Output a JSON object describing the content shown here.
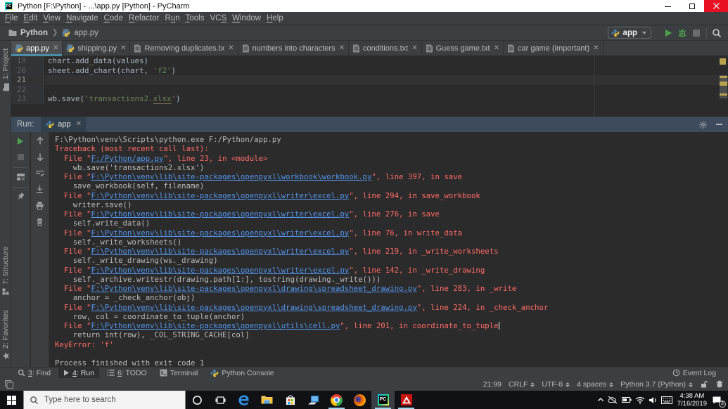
{
  "window": {
    "title": "Python [F:\\Python] - ...\\app.py [Python] - PyCharm",
    "controls": [
      "minimize",
      "maximize",
      "close"
    ]
  },
  "menu": {
    "items": [
      {
        "label": "File",
        "mnemonic": 0
      },
      {
        "label": "Edit",
        "mnemonic": 0
      },
      {
        "label": "View",
        "mnemonic": 0
      },
      {
        "label": "Navigate",
        "mnemonic": 0
      },
      {
        "label": "Code",
        "mnemonic": 0
      },
      {
        "label": "Refactor",
        "mnemonic": 0
      },
      {
        "label": "Run",
        "mnemonic": 1
      },
      {
        "label": "Tools",
        "mnemonic": 0
      },
      {
        "label": "VCS",
        "mnemonic": 2
      },
      {
        "label": "Window",
        "mnemonic": 0
      },
      {
        "label": "Help",
        "mnemonic": 0
      }
    ]
  },
  "toolbar": {
    "breadcrumb": [
      {
        "label": "Python",
        "icon": "folder-icon"
      },
      {
        "label": "app.py",
        "icon": "python-file-icon"
      }
    ],
    "run_config": {
      "label": "app",
      "icon": "python-icon"
    },
    "buttons": [
      "run-button",
      "debug-button",
      "stop-button",
      "search-everywhere-button"
    ]
  },
  "editor_tabs": [
    {
      "label": "app.py",
      "icon": "python-file-icon",
      "active": true
    },
    {
      "label": "shipping.py",
      "icon": "python-file-icon",
      "active": false
    },
    {
      "label": "Removing duplicates.tx",
      "icon": "text-file-icon",
      "active": false
    },
    {
      "label": "numbers into characters",
      "icon": "text-file-icon",
      "active": false
    },
    {
      "label": "conditions.txt",
      "icon": "text-file-icon",
      "active": false
    },
    {
      "label": "Guess game.txt",
      "icon": "text-file-icon",
      "active": false
    },
    {
      "label": "car game (important)",
      "icon": "text-file-icon",
      "active": false
    }
  ],
  "editor": {
    "lines": [
      {
        "num": "19",
        "current": false,
        "segments": [
          {
            "text": "chart.add_data(values)",
            "style": "code"
          }
        ]
      },
      {
        "num": "20",
        "current": false,
        "segments": [
          {
            "text": "sheet.add_chart(chart, ",
            "style": "code"
          },
          {
            "text": "'f2'",
            "style": "string"
          },
          {
            "text": ")",
            "style": "code"
          }
        ]
      },
      {
        "num": "21",
        "current": true,
        "segments": []
      },
      {
        "num": "22",
        "current": false,
        "segments": []
      },
      {
        "num": "23",
        "current": false,
        "segments": [
          {
            "text": "wb.save(",
            "style": "code"
          },
          {
            "text": "'transactions2.",
            "style": "string"
          },
          {
            "text": "xlsx",
            "style": "string-typo"
          },
          {
            "text": "'",
            "style": "string"
          },
          {
            "text": ")",
            "style": "code"
          }
        ]
      }
    ]
  },
  "tool_stripes": {
    "left_top": [
      {
        "label": "1: Project",
        "icon": "folder-icon"
      }
    ],
    "left_bottom": [
      {
        "label": "7: Structure",
        "icon": "structure-icon"
      },
      {
        "label": "2: Favorites",
        "icon": "star-icon"
      }
    ]
  },
  "run_panel": {
    "header_label": "Run:",
    "tab": {
      "label": "app",
      "icon": "python-icon"
    },
    "header_buttons": [
      "settings-gear-icon",
      "hide-icon"
    ],
    "toolbar_left": [
      "rerun-button",
      "stop-button",
      "layout-button",
      "pin-button"
    ],
    "toolbar_inner": [
      "up-stack-trace-button",
      "down-stack-trace-button",
      "soft-wrap-button",
      "scroll-to-end-button",
      "print-button",
      "clear-all-button"
    ]
  },
  "console": {
    "lines": [
      {
        "segments": [
          {
            "text": "F:\\Python\\venv\\Scripts\\python.exe F:/Python/app.py",
            "style": "out"
          }
        ]
      },
      {
        "segments": [
          {
            "text": "Traceback (most recent call last):",
            "style": "err"
          }
        ]
      },
      {
        "segments": [
          {
            "text": "  File \"",
            "style": "err"
          },
          {
            "text": "F:/Python/app.py",
            "style": "link"
          },
          {
            "text": "\", line 23, in <module>",
            "style": "err"
          }
        ]
      },
      {
        "segments": [
          {
            "text": "    wb.save('transactions2.xlsx')",
            "style": "out"
          }
        ]
      },
      {
        "segments": [
          {
            "text": "  File \"",
            "style": "err"
          },
          {
            "text": "F:\\Python\\venv\\lib\\site-packages\\openpyxl\\workbook\\workbook.py",
            "style": "link"
          },
          {
            "text": "\", line 397, in save",
            "style": "err"
          }
        ]
      },
      {
        "segments": [
          {
            "text": "    save_workbook(self, filename)",
            "style": "out"
          }
        ]
      },
      {
        "segments": [
          {
            "text": "  File \"",
            "style": "err"
          },
          {
            "text": "F:\\Python\\venv\\lib\\site-packages\\openpyxl\\writer\\excel.py",
            "style": "link"
          },
          {
            "text": "\", line 294, in save_workbook",
            "style": "err"
          }
        ]
      },
      {
        "segments": [
          {
            "text": "    writer.save()",
            "style": "out"
          }
        ]
      },
      {
        "segments": [
          {
            "text": "  File \"",
            "style": "err"
          },
          {
            "text": "F:\\Python\\venv\\lib\\site-packages\\openpyxl\\writer\\excel.py",
            "style": "link"
          },
          {
            "text": "\", line 276, in save",
            "style": "err"
          }
        ]
      },
      {
        "segments": [
          {
            "text": "    self.write_data()",
            "style": "out"
          }
        ]
      },
      {
        "segments": [
          {
            "text": "  File \"",
            "style": "err"
          },
          {
            "text": "F:\\Python\\venv\\lib\\site-packages\\openpyxl\\writer\\excel.py",
            "style": "link"
          },
          {
            "text": "\", line 76, in write_data",
            "style": "err"
          }
        ]
      },
      {
        "segments": [
          {
            "text": "    self._write_worksheets()",
            "style": "out"
          }
        ]
      },
      {
        "segments": [
          {
            "text": "  File \"",
            "style": "err"
          },
          {
            "text": "F:\\Python\\venv\\lib\\site-packages\\openpyxl\\writer\\excel.py",
            "style": "link"
          },
          {
            "text": "\", line 219, in _write_worksheets",
            "style": "err"
          }
        ]
      },
      {
        "segments": [
          {
            "text": "    self._write_drawing(ws._drawing)",
            "style": "out"
          }
        ]
      },
      {
        "segments": [
          {
            "text": "  File \"",
            "style": "err"
          },
          {
            "text": "F:\\Python\\venv\\lib\\site-packages\\openpyxl\\writer\\excel.py",
            "style": "link"
          },
          {
            "text": "\", line 142, in _write_drawing",
            "style": "err"
          }
        ]
      },
      {
        "segments": [
          {
            "text": "    self._archive.writestr(drawing.path[1:], tostring(drawing._write()))",
            "style": "out"
          }
        ]
      },
      {
        "segments": [
          {
            "text": "  File \"",
            "style": "err"
          },
          {
            "text": "F:\\Python\\venv\\lib\\site-packages\\openpyxl\\drawing\\spreadsheet_drawing.py",
            "style": "link"
          },
          {
            "text": "\", line 283, in _write",
            "style": "err"
          }
        ]
      },
      {
        "segments": [
          {
            "text": "    anchor = _check_anchor(obj)",
            "style": "out"
          }
        ]
      },
      {
        "segments": [
          {
            "text": "  File \"",
            "style": "err"
          },
          {
            "text": "F:\\Python\\venv\\lib\\site-packages\\openpyxl\\drawing\\spreadsheet_drawing.py",
            "style": "link"
          },
          {
            "text": "\", line 224, in _check_anchor",
            "style": "err"
          }
        ]
      },
      {
        "segments": [
          {
            "text": "    row, col = coordinate_to_tuple(anchor)",
            "style": "out"
          }
        ]
      },
      {
        "segments": [
          {
            "text": "  File \"",
            "style": "err"
          },
          {
            "text": "F:\\Python\\venv\\lib\\site-packages\\openpyxl\\utils\\cell.py",
            "style": "link"
          },
          {
            "text": "\", line 201, in coordinate_to_tuple",
            "style": "err"
          }
        ],
        "caret": true
      },
      {
        "segments": [
          {
            "text": "    return int(row), _COL_STRING_CACHE[col]",
            "style": "out"
          }
        ]
      },
      {
        "segments": [
          {
            "text": "KeyError: 'f'",
            "style": "err"
          }
        ]
      },
      {
        "segments": []
      },
      {
        "segments": [
          {
            "text": "Process finished with exit code 1",
            "style": "out"
          }
        ]
      }
    ]
  },
  "bottom_bar": {
    "items": [
      {
        "label": "3: Find",
        "mnemonic": 0,
        "icon": "search-icon",
        "active": false
      },
      {
        "label": "4: Run",
        "mnemonic": 0,
        "icon": "run-icon",
        "active": true
      },
      {
        "label": "6: TODO",
        "mnemonic": 0,
        "icon": "todo-icon",
        "active": false
      },
      {
        "label": "Terminal",
        "mnemonic": -1,
        "icon": "terminal-icon",
        "active": false
      },
      {
        "label": "Python Console",
        "mnemonic": -1,
        "icon": "python-icon",
        "active": false
      }
    ],
    "right": {
      "label": "Event Log",
      "icon": "clock-icon"
    }
  },
  "status_bar": {
    "caret_position": "21:99",
    "line_ending": "CRLF",
    "encoding": "UTF-8",
    "indent": "4 spaces",
    "interpreter": "Python 3.7 (Python)",
    "icons": [
      "unlocked-padlock-icon",
      "inspections-hector-icon"
    ]
  },
  "taskbar": {
    "search_placeholder": "Type here to search",
    "apps": [
      {
        "name": "edge",
        "open": false,
        "active": false
      },
      {
        "name": "explorer",
        "open": false,
        "active": false
      },
      {
        "name": "store",
        "open": false,
        "active": false
      },
      {
        "name": "pc-laptop",
        "open": false,
        "active": false
      },
      {
        "name": "chrome",
        "open": true,
        "active": false
      },
      {
        "name": "firefox",
        "open": false,
        "active": false
      },
      {
        "name": "pycharm",
        "open": true,
        "active": true
      },
      {
        "name": "acrobat",
        "open": true,
        "active": false
      }
    ],
    "tray": {
      "time": "4:38 AM",
      "date": "7/16/2019",
      "notification_badge": "3",
      "icons": [
        "chevron-up-icon",
        "onedrive-icon",
        "battery-icon",
        "wifi-icon",
        "volume-icon",
        "touch-keyboard-icon"
      ]
    }
  },
  "colors": {
    "panel": "#3c3f41",
    "editor_bg": "#2b2b2b",
    "error_red": "#ff6b68",
    "link_blue": "#5394ec",
    "string_green": "#6a8759",
    "tab_underline": "#4a8da8",
    "run_header": "#3d4b5c",
    "close_red": "#e81123"
  }
}
